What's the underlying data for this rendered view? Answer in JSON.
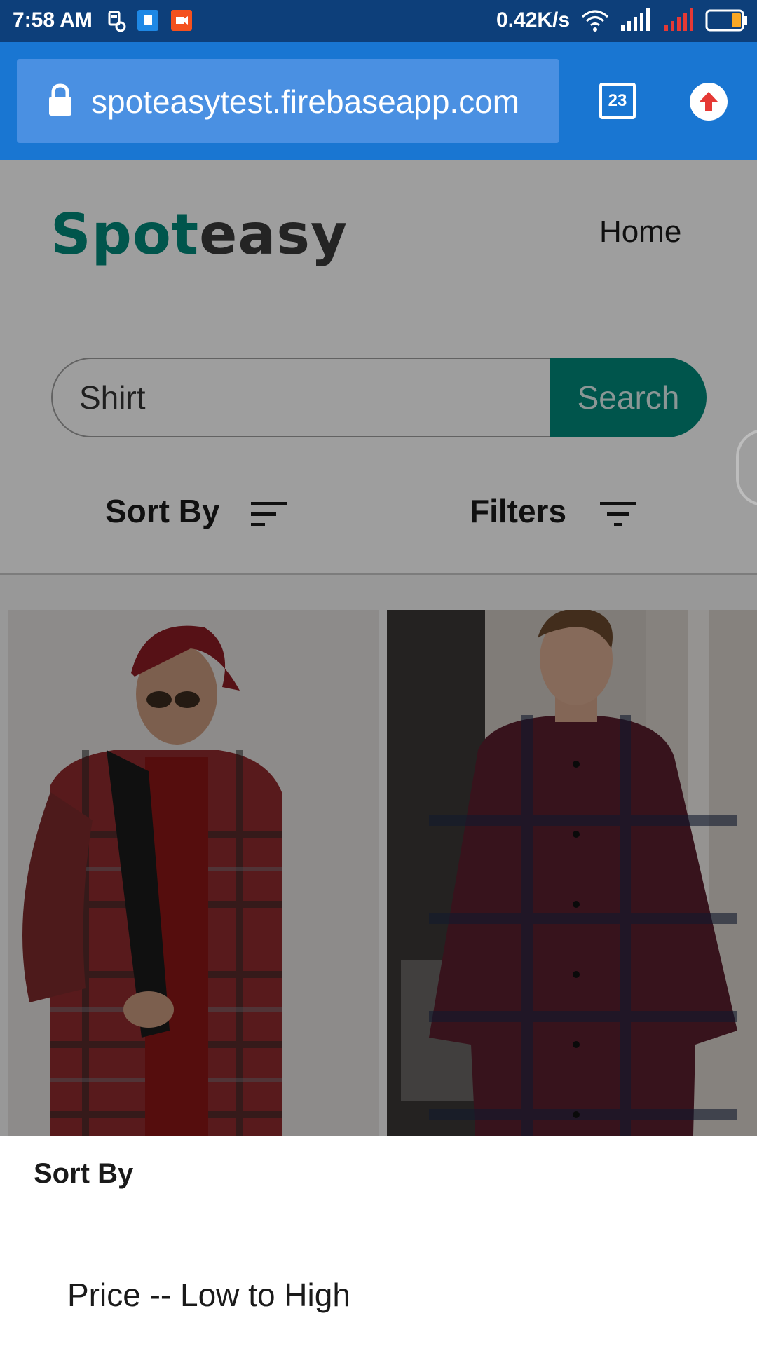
{
  "status_bar": {
    "time": "7:58 AM",
    "network_speed": "0.42K/s",
    "icons": [
      "data-saver-icon",
      "notification-app-icon",
      "video-app-icon",
      "wifi-icon",
      "signal-icon",
      "signal-no-service-icon",
      "battery-icon"
    ]
  },
  "browser": {
    "url": "spoteasytest.firebaseapp.com",
    "tab_count": "23",
    "icons": [
      "lock-icon",
      "update-arrow-icon"
    ]
  },
  "site": {
    "logo_part1": "Spot",
    "logo_part2": "easy",
    "nav_home": "Home"
  },
  "search": {
    "value": "Shirt",
    "button_label": "Search"
  },
  "controls": {
    "sort_label": "Sort By",
    "filter_label": "Filters"
  },
  "products": [
    {
      "description": "Man in red cap and plaid shirt with backpack"
    },
    {
      "description": "Young man in dark red plaid shirt"
    }
  ],
  "bottom_sheet": {
    "title": "Sort By",
    "options": [
      "Price -- Low to High"
    ]
  },
  "colors": {
    "status_bar": "#0d3f7a",
    "browser_bar": "#1976d2",
    "brand_teal": "#00897b",
    "logo_dark": "#3a3a3a"
  }
}
